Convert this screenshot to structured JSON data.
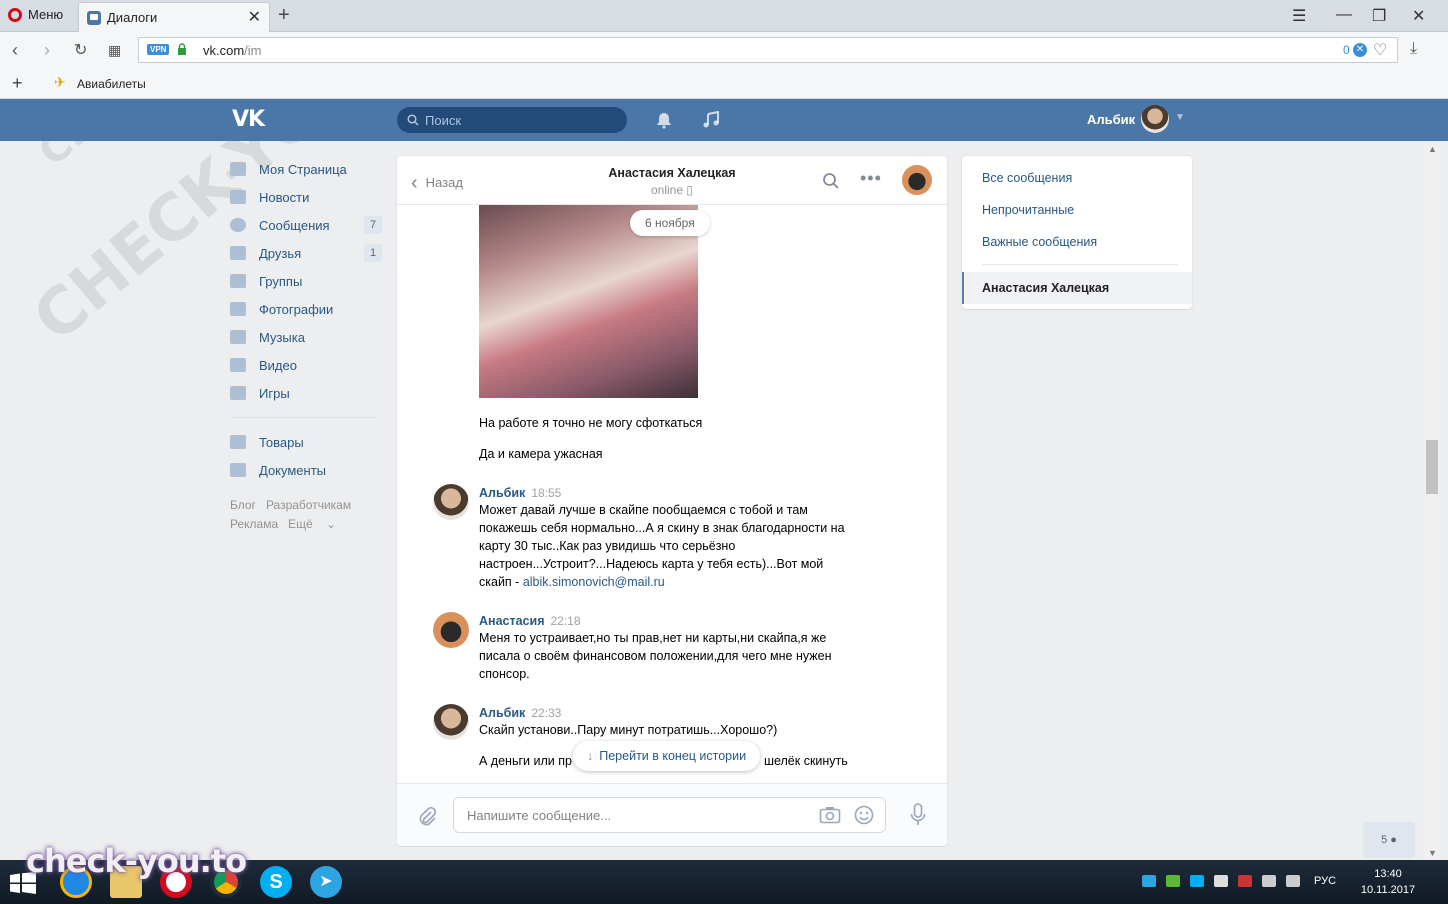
{
  "browser": {
    "menu_label": "Меню",
    "tab_title": "Диалоги",
    "url_host": "vk.com",
    "url_path": "/im",
    "adblock_count": "0",
    "bookmark": "Авиабилеты"
  },
  "header": {
    "search_placeholder": "Поиск",
    "username": "Альбик",
    "logo": "VK"
  },
  "leftnav": {
    "items": [
      {
        "label": "Моя Страница",
        "badge": ""
      },
      {
        "label": "Новости",
        "badge": ""
      },
      {
        "label": "Сообщения",
        "badge": "7"
      },
      {
        "label": "Друзья",
        "badge": "1"
      },
      {
        "label": "Группы",
        "badge": ""
      },
      {
        "label": "Фотографии",
        "badge": ""
      },
      {
        "label": "Музыка",
        "badge": ""
      },
      {
        "label": "Видео",
        "badge": ""
      },
      {
        "label": "Игры",
        "badge": ""
      }
    ],
    "items2": [
      {
        "label": "Товары"
      },
      {
        "label": "Документы"
      }
    ],
    "footer": [
      "Блог",
      "Разработчикам",
      "Реклама",
      "Ещё"
    ]
  },
  "chat": {
    "back_label": "Назад",
    "peer_name": "Анастасия Халецкая",
    "peer_status": "online",
    "date_pill": "6 ноября",
    "messages": [
      {
        "text": "На работе я точно не могу сфоткаться"
      },
      {
        "text": "Да и камера ужасная"
      },
      {
        "author": "Альбик",
        "time": "18:55",
        "text": "Может давай лучше в скайпе пообщаемся с тобой и там покажешь себя нормально...А я скину в знак благодарности на карту 30 тыс..Как раз увидишь что серьёзно настроен...Устроит?...Надеюсь карта у тебя есть)...Вот мой скайп - ",
        "link": "albik.simonovich@mail.ru"
      },
      {
        "author": "Анастасия",
        "time": "22:18",
        "text": "Меня то устраивает,но ты прав,нет ни карты,ни скайпа,я же писала о своём финансовом положении,для чего мне нужен спонсор."
      },
      {
        "author": "Альбик",
        "time": "22:33",
        "text": "Скайп установи..Пару минут потратишь...Хорошо?)"
      },
      {
        "text_left": "А деньги или пр",
        "text_right": "шелёк скинуть"
      }
    ],
    "goto_end": "Перейти в конец истории",
    "input_placeholder": "Напишите сообщение..."
  },
  "rightpanel": {
    "links": [
      "Все сообщения",
      "Непрочитанные",
      "Важные сообщения"
    ],
    "active": "Анастасия Халецкая"
  },
  "online_friends": "5",
  "taskbar": {
    "lang": "РУС",
    "time": "13:40",
    "date": "10.11.2017"
  },
  "watermark": "check-you.to",
  "watermark_diag": "CHECK-YOU.ME",
  "colors": {
    "vk_blue": "#4a76a8",
    "link": "#2a5885",
    "opera_red": "#d20b1e"
  }
}
